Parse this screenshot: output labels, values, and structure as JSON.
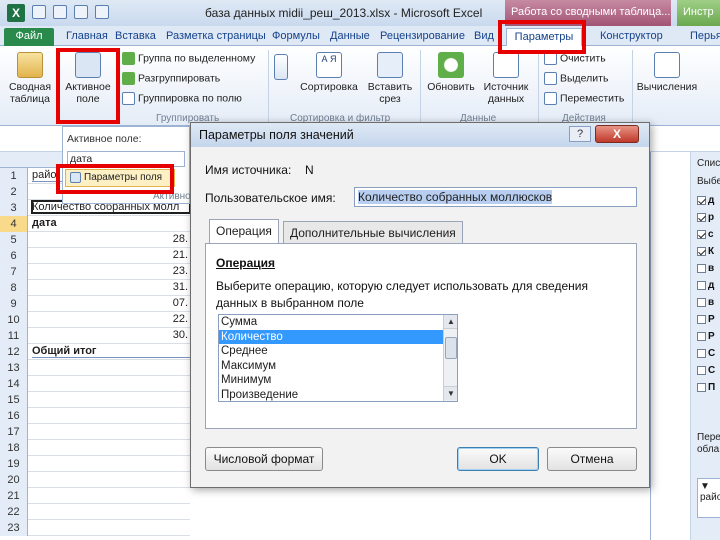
{
  "app": {
    "logo": "X",
    "window_title": "база данных midii_реш_2013.xlsx - Microsoft Excel",
    "context_group": "Работа со сводными таблица...",
    "context_group2": "Инстр"
  },
  "tabs": [
    "Файл",
    "Главная",
    "Вставка",
    "Разметка страницы",
    "Формулы",
    "Данные",
    "Рецензирование",
    "Вид",
    "Параметры",
    "Конструктор",
    "Перья"
  ],
  "ribbon": {
    "pivot_table": "Сводная таблица",
    "active_field": "Активное поле",
    "group_selection": "Группа по выделенному",
    "ungroup": "Разгруппировать",
    "group_field": "Группировка по полю",
    "group_label_group": "Группировать",
    "sort_az": "А Я",
    "sort": "Сортировка",
    "slicer": "Вставить срез",
    "sort_group": "Сортировка и фильтр",
    "refresh": "Обновить",
    "source": "Источник данных",
    "data_group": "Данные",
    "clear": "Очистить",
    "select": "Выделить",
    "move": "Переместить",
    "actions_group": "Действия",
    "calcs": "Вычисления"
  },
  "field_dropdown": {
    "label": "Активное поле:",
    "value": "дата",
    "settings_button": "Параметры поля",
    "group_caption": "Активное"
  },
  "sheet": {
    "rows": [
      {
        "num": "1",
        "text": "райо",
        "style": "underline"
      },
      {
        "num": "2",
        "text": "",
        "style": ""
      },
      {
        "num": "3",
        "text": "Количество собранных молл",
        "style": "selcell"
      },
      {
        "num": "4",
        "text": "дата",
        "style": "bold",
        "selected": true
      },
      {
        "num": "5",
        "text": "28.",
        "style": "right"
      },
      {
        "num": "6",
        "text": "21.",
        "style": "right"
      },
      {
        "num": "7",
        "text": "23.",
        "style": "right"
      },
      {
        "num": "8",
        "text": "31.",
        "style": "right"
      },
      {
        "num": "9",
        "text": "07.",
        "style": "right"
      },
      {
        "num": "10",
        "text": "22.",
        "style": "right"
      },
      {
        "num": "11",
        "text": "30.",
        "style": "right"
      },
      {
        "num": "12",
        "text": "Общий итог",
        "style": "bold underline"
      },
      {
        "num": "13",
        "text": ""
      },
      {
        "num": "14",
        "text": ""
      },
      {
        "num": "15",
        "text": ""
      },
      {
        "num": "16",
        "text": ""
      },
      {
        "num": "17",
        "text": ""
      },
      {
        "num": "18",
        "text": ""
      },
      {
        "num": "19",
        "text": ""
      },
      {
        "num": "20",
        "text": ""
      },
      {
        "num": "21",
        "text": ""
      },
      {
        "num": "22",
        "text": ""
      },
      {
        "num": "23",
        "text": ""
      }
    ]
  },
  "field_list": {
    "header": "Спис",
    "choose": "Выбе",
    "items": [
      {
        "label": "д",
        "checked": true
      },
      {
        "label": "р",
        "checked": true
      },
      {
        "label": "с",
        "checked": true
      },
      {
        "label": "К",
        "checked": true
      },
      {
        "label": "в",
        "checked": false
      },
      {
        "label": "д",
        "checked": false
      },
      {
        "label": "в",
        "checked": false
      },
      {
        "label": "Р",
        "checked": false
      },
      {
        "label": "Р",
        "checked": false
      },
      {
        "label": "С",
        "checked": false
      },
      {
        "label": "С",
        "checked": false
      },
      {
        "label": "П",
        "checked": false
      }
    ],
    "bottom_text1": "Пере",
    "bottom_text2": "обла",
    "filter_value": "райо"
  },
  "dialog": {
    "title": "Параметры поля значений",
    "help": "?",
    "close": "X",
    "source_label": "Имя источника:",
    "source_value": "N",
    "custom_label": "Пользовательское имя:",
    "custom_value": "Количество собранных моллюсков",
    "tab1": "Операция",
    "tab2": "Дополнительные вычисления",
    "section_title": "Операция",
    "instruction": "Выберите операцию, которую следует использовать для сведения данных в выбранном поле",
    "operations": [
      "Сумма",
      "Количество",
      "Среднее",
      "Максимум",
      "Минимум",
      "Произведение"
    ],
    "selected_operation": "Количество",
    "number_format": "Числовой формат",
    "ok": "OK",
    "cancel": "Отмена"
  }
}
